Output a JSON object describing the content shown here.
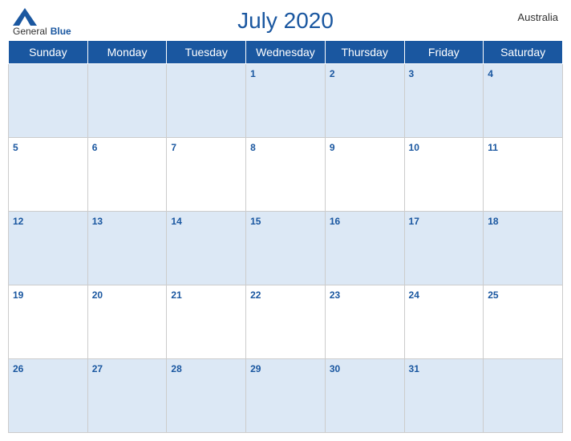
{
  "header": {
    "logo_general": "General",
    "logo_blue": "Blue",
    "title": "July 2020",
    "country": "Australia"
  },
  "days_of_week": [
    "Sunday",
    "Monday",
    "Tuesday",
    "Wednesday",
    "Thursday",
    "Friday",
    "Saturday"
  ],
  "weeks": [
    [
      null,
      null,
      null,
      1,
      2,
      3,
      4
    ],
    [
      5,
      6,
      7,
      8,
      9,
      10,
      11
    ],
    [
      12,
      13,
      14,
      15,
      16,
      17,
      18
    ],
    [
      19,
      20,
      21,
      22,
      23,
      24,
      25
    ],
    [
      26,
      27,
      28,
      29,
      30,
      31,
      null
    ]
  ]
}
